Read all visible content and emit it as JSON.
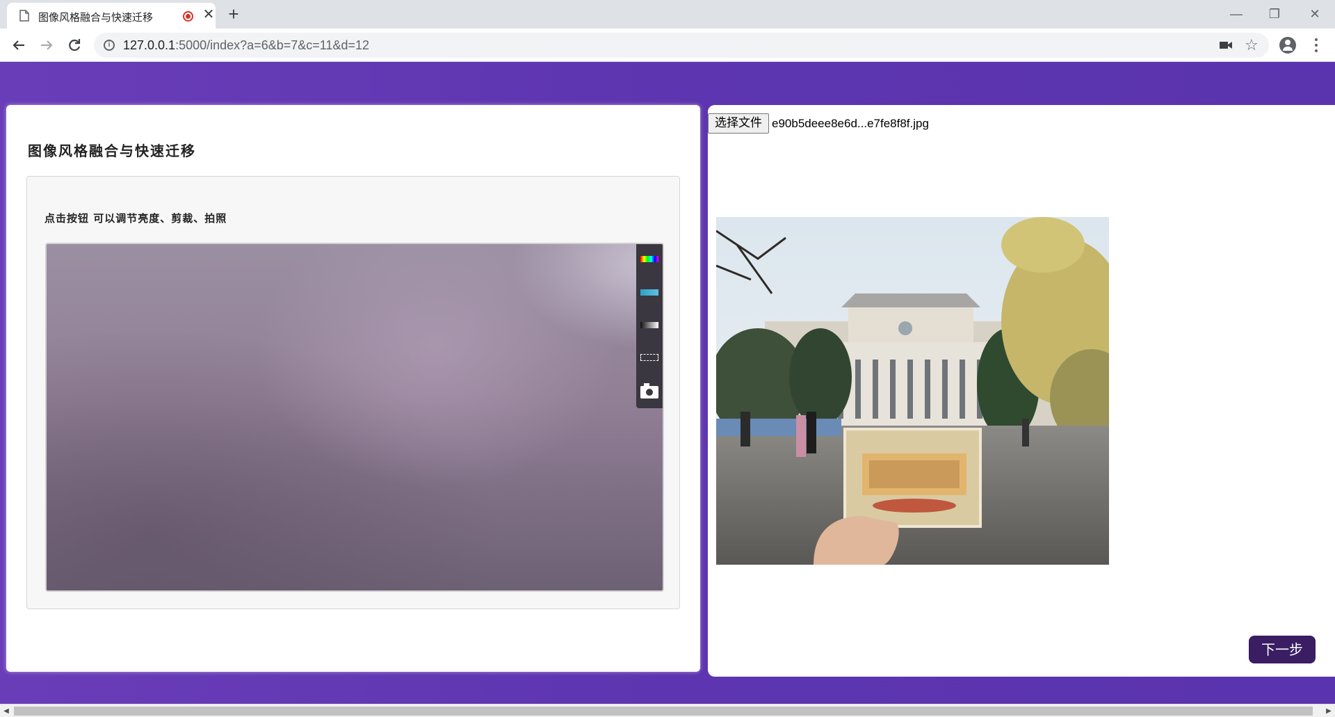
{
  "browser": {
    "tab_title": "图像风格融合与快速迁移",
    "tab_close": "✕",
    "new_tab": "+",
    "url_host": "127.0.0.1",
    "url_rest": ":5000/index?a=6&b=7&c=11&d=12",
    "window_minimize": "—",
    "window_restore": "❐",
    "window_close": "✕"
  },
  "left_card": {
    "title": "图像风格融合与快速迁移",
    "hint": "点击按钮 可以调节亮度、剪裁、拍照",
    "camera_tools": [
      "color-filter",
      "tint",
      "brightness",
      "crop",
      "snapshot"
    ]
  },
  "right_card": {
    "file_button_label": "选择文件",
    "file_name": "e90b5deee8e6d...e7fe8f8f.jpg",
    "next_button_label": "下一步"
  },
  "colors": {
    "page_background": "#5b3ab0",
    "next_button": "#3a1d63",
    "recording_indicator": "#d93025"
  }
}
